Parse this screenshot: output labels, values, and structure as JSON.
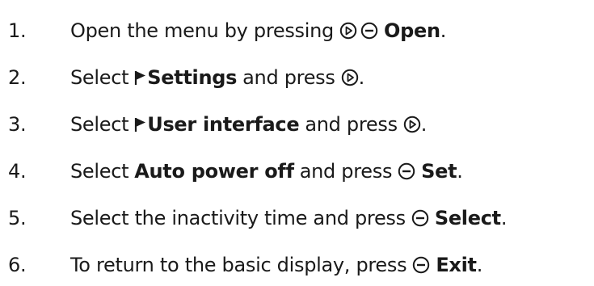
{
  "steps": [
    {
      "number": "1.",
      "parts": [
        "Open the menu by pressing",
        "Open",
        "."
      ]
    },
    {
      "number": "2.",
      "parts": [
        "Select",
        "Settings",
        "and press",
        "."
      ]
    },
    {
      "number": "3.",
      "parts": [
        "Select",
        "User interface",
        "and press",
        "."
      ]
    },
    {
      "number": "4.",
      "parts": [
        "Select",
        "Auto power off",
        "and press",
        "Set",
        "."
      ]
    },
    {
      "number": "5.",
      "parts": [
        "Select the inactivity time and press",
        "Select",
        "."
      ]
    },
    {
      "number": "6.",
      "parts": [
        "To return to the basic display, press",
        "Exit",
        "."
      ]
    }
  ],
  "icons": {
    "play_button": "play-circle-icon",
    "minus_button": "minus-circle-icon",
    "menu_arrow": "menu-arrow-icon"
  },
  "colors": {
    "text": "#1a1a1a"
  }
}
